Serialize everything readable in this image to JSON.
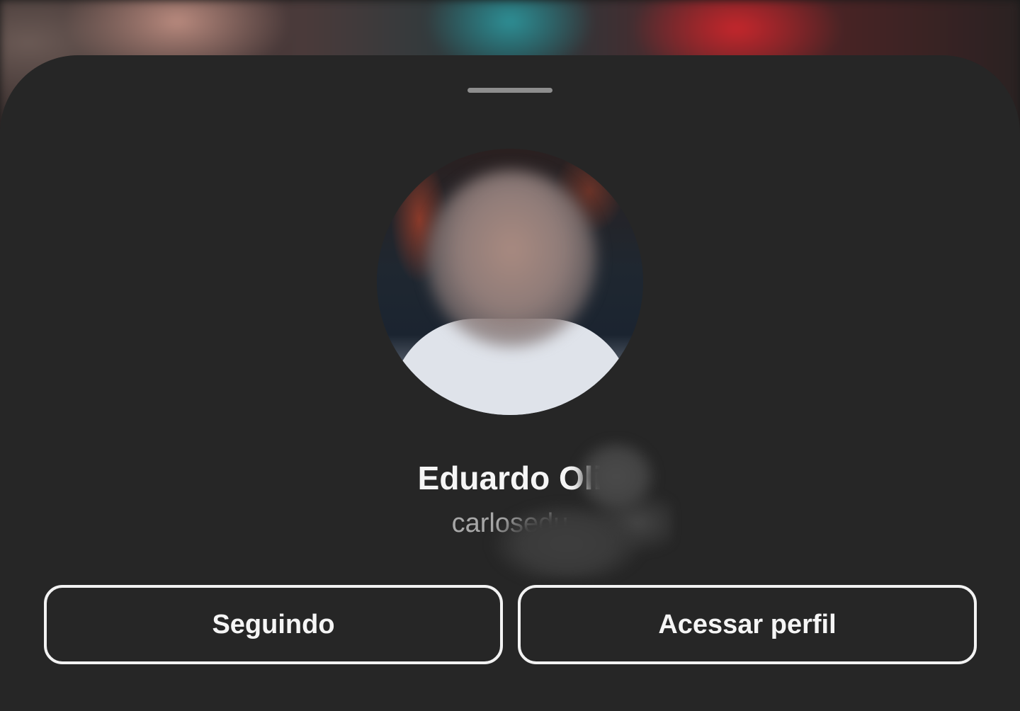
{
  "sheet": {
    "profile": {
      "display_name": "Eduardo Oli",
      "username": "carlosedu"
    },
    "actions": {
      "following_label": "Seguindo",
      "view_profile_label": "Acessar perfil"
    }
  },
  "colors": {
    "sheet_background": "#262626",
    "button_border": "#f2f2f2",
    "primary_text": "#f5f5f5",
    "secondary_text": "#a8a8a8"
  }
}
